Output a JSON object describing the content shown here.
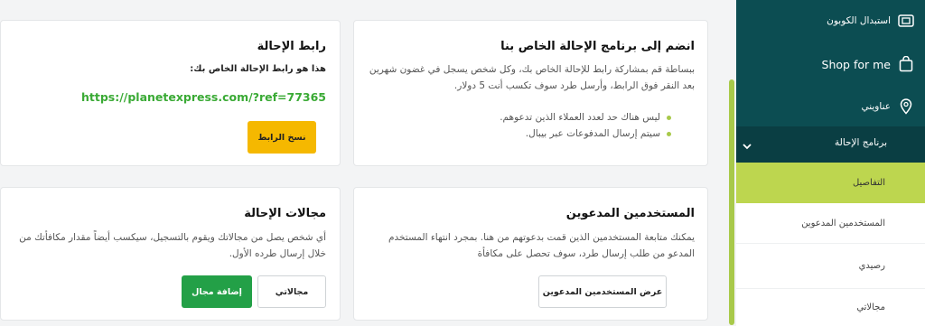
{
  "referral_link_card": {
    "title": "رابط الإحالة",
    "subtitle": "هذا هو رابط الإحالة الخاص بك:",
    "link": "https://planetexpress.com/?ref=77365",
    "copy_button": "نسخ الرابط"
  },
  "join_program_card": {
    "title": "انضم إلى برنامج الإحالة الخاص بنا",
    "description": "ببساطة قم بمشاركة رابط للإحالة الخاص بك، وكل شخص يسجل في غضون شهرين بعد النقر فوق الرابط، وأرسل طرد سوف تكسب أنت 5 دولار.",
    "bullets": [
      "ليس هناك حد لعدد العملاء الذين تدعوهم.",
      "سيتم إرسال المدفوعات عبر بيبال."
    ]
  },
  "referral_domains_card": {
    "title": "مجالات الإحالة",
    "description": "أي شخص يصل من مجالاتك ويقوم بالتسجيل، سيكسب أيضاً مقدار مكافأتك من خلال إرسال طرده الأول.",
    "my_domains_button": "مجالاتي",
    "add_domain_button": "إضافة مجال"
  },
  "invited_users_card": {
    "title": "المستخدمين المدعوين",
    "description": "يمكنك متابعة المستخدمين الذين قمت بدعوتهم من هنا. بمجرد انتهاء المستخدم المدعو من طلب إرسال طرد، سوف تحصل على مكافأة",
    "view_button": "عرض المستخدمين المدعوين"
  },
  "sidebar": {
    "items": [
      {
        "label": "استبدال الكوبون",
        "icon": "ticket-icon"
      },
      {
        "label": "Shop for me",
        "icon": "shopping-bag-icon"
      },
      {
        "label": "عناويني",
        "icon": "location-pin-icon"
      },
      {
        "label": "برنامج الإحالة",
        "icon": "chevron-down-icon"
      }
    ],
    "submenu": [
      {
        "label": "التفاصيل"
      },
      {
        "label": "المستخدمين المدعوين"
      },
      {
        "label": "رصيدي"
      },
      {
        "label": "مجالاتي"
      }
    ]
  },
  "colors": {
    "sidebar_bg": "#0c4d52",
    "sidebar_active": "#0a3e43",
    "accent_green": "#a8c94a",
    "link_green": "#3aaa35",
    "copy_button_bg": "#f5b800",
    "add_button_bg": "#23a047"
  }
}
